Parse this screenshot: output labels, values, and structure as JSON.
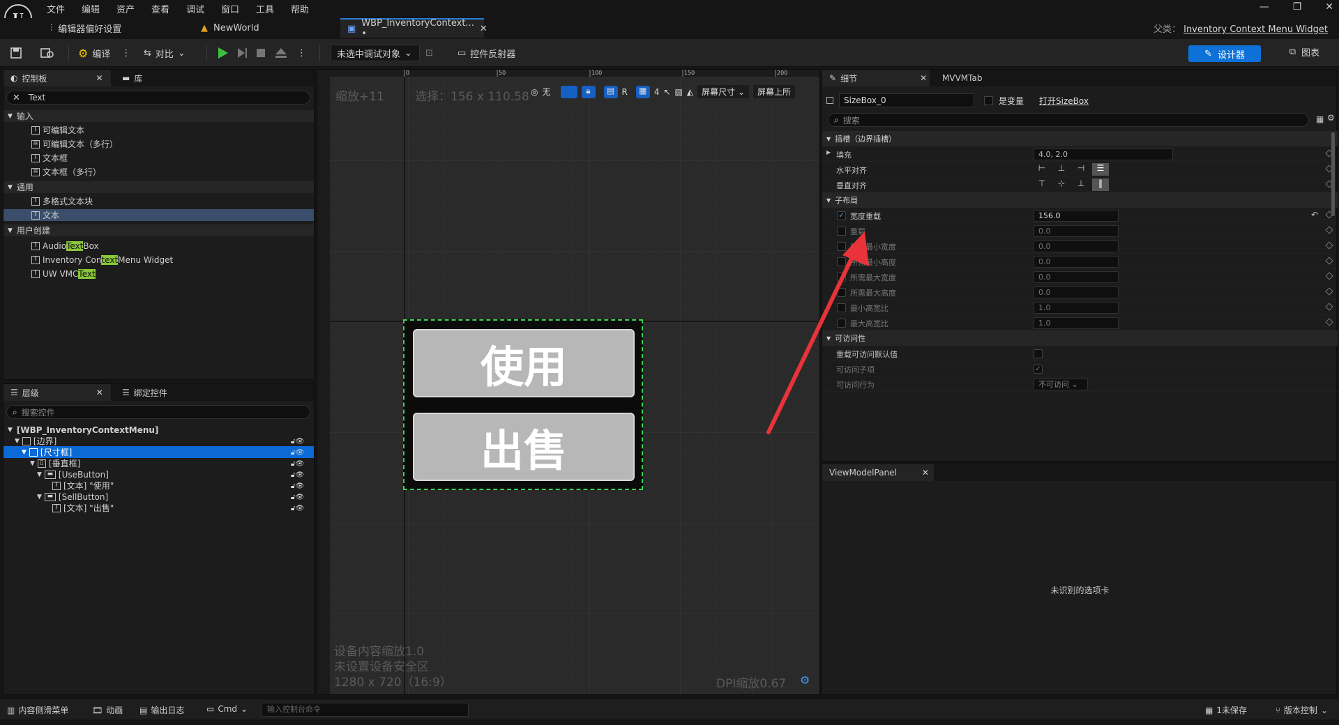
{
  "menu": [
    "文件",
    "编辑",
    "资产",
    "查看",
    "调试",
    "窗口",
    "工具",
    "帮助"
  ],
  "tabs": {
    "settings": "编辑器偏好设置",
    "world": "NewWorld",
    "active": "WBP_InventoryContext... •"
  },
  "parent": {
    "label": "父类：",
    "value": "Inventory Context Menu Widget"
  },
  "toolbar": {
    "compile": "编译",
    "diff": "对比",
    "debug_target": "未选中调试对象",
    "reflector": "控件反射器",
    "designer": "设计器",
    "graph": "图表"
  },
  "palette": {
    "tab": "控制板",
    "lib_tab": "库",
    "search": "Text",
    "cat_input": "输入",
    "input_items": [
      "可编辑文本",
      "可编辑文本（多行）",
      "文本框",
      "文本框（多行）"
    ],
    "cat_common": "通用",
    "common_items": [
      "多格式文本块",
      "文本"
    ],
    "cat_user": "用户创建",
    "user_items": [
      {
        "pre": "Audio ",
        "hl": "Text",
        "post": " Box"
      },
      {
        "pre": "Inventory Con",
        "hl": "text",
        "post": "Menu Widget"
      },
      {
        "pre": "UW VMC",
        "hl": "Text",
        "post": ""
      }
    ]
  },
  "hierarchy": {
    "tab": "层级",
    "bind_tab": "绑定控件",
    "search_placeholder": "搜索控件",
    "root": "[WBP_InventoryContextMenu]",
    "items": [
      "[边界]",
      "[尺寸框]",
      "[垂直框]",
      "[UseButton]",
      "[文本] \"使用\"",
      "[SellButton]",
      "[文本] \"出售\""
    ]
  },
  "canvas": {
    "zoom": "缩放+11",
    "selection": "选择：156 x 110.58",
    "none_label": "无",
    "r_label": "R",
    "grid_label": "4",
    "screen_size": "屏幕尺寸",
    "screen_fill": "屏幕上所",
    "ruler_top": [
      "0",
      "50",
      "100",
      "150",
      "200"
    ],
    "btn_use": "使用",
    "btn_sell": "出售",
    "info1": "设备内容缩放1.0",
    "info2": "未设置设备安全区",
    "info3": "1280 x 720（16:9）",
    "dpi": "DPI缩放0.67"
  },
  "details": {
    "tab": "细节",
    "mvvm_tab": "MVVMTab",
    "name": "SizeBox_0",
    "is_var": "是变量",
    "open": "打开SizeBox",
    "search_placeholder": "搜索",
    "sect_slot": "插槽（边界插槽）",
    "fill_label": "填充",
    "fill_value": "4.0, 2.0",
    "halign": "水平对齐",
    "valign": "垂直对齐",
    "sect_child": "子布局",
    "child_rows": [
      {
        "label": "宽度重载",
        "value": "156.0",
        "checked": true
      },
      {
        "label": "重载",
        "value": "0.0",
        "checked": false
      },
      {
        "label": "所需最小宽度",
        "value": "0.0",
        "checked": false
      },
      {
        "label": "所需最小高度",
        "value": "0.0",
        "checked": false
      },
      {
        "label": "所需最大宽度",
        "value": "0.0",
        "checked": false
      },
      {
        "label": "所需最大高度",
        "value": "0.0",
        "checked": false
      },
      {
        "label": "最小高宽比",
        "value": "1.0",
        "checked": false
      },
      {
        "label": "最大高宽比",
        "value": "1.0",
        "checked": false
      }
    ],
    "sect_access": "可访问性",
    "access_override": "重载可访问默认值",
    "access_children": "可访问子项",
    "access_behavior": "可访问行为",
    "access_behavior_val": "不可访问"
  },
  "viewmodel": {
    "tab": "ViewModelPanel",
    "empty": "未识别的选项卡"
  },
  "status": {
    "drawer": "内容侧滑菜单",
    "anim": "动画",
    "log": "输出日志",
    "cmd": "Cmd",
    "cmd_placeholder": "输入控制台命令",
    "unsaved": "1未保存",
    "vc": "版本控制"
  },
  "colors": {
    "accent": "#0e71d7",
    "selection": "#0b6ad6",
    "highlight": "#8ac73a",
    "arrow": "#e8333a",
    "canvas_outline": "#39d353"
  }
}
